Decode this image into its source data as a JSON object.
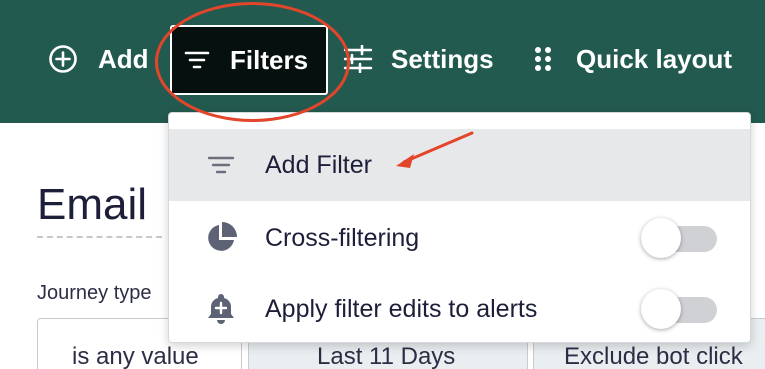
{
  "toolbar": {
    "add_label": "Add",
    "filters_label": "Filters",
    "settings_label": "Settings",
    "quick_layout_label": "Quick layout",
    "icons": [
      "plus-circle-icon",
      "filter-lines-icon",
      "sliders-icon",
      "drag-dots-icon"
    ],
    "background_color": "#235a4f",
    "active_button_color": "#06100e"
  },
  "page": {
    "title": "Email",
    "filter_label": "Journey type",
    "filters": [
      "is any value",
      "Last 11 Days",
      "Exclude bot click"
    ]
  },
  "menu": {
    "items": [
      {
        "label": "Add Filter",
        "icon": "filter-lines-icon",
        "highlighted": true
      },
      {
        "label": "Cross-filtering",
        "icon": "pie-chart-icon",
        "toggle": false
      },
      {
        "label": "Apply filter edits to alerts",
        "icon": "bell-add-icon",
        "toggle": false
      }
    ]
  },
  "annotations": {
    "highlight_color": "#e3452b"
  }
}
